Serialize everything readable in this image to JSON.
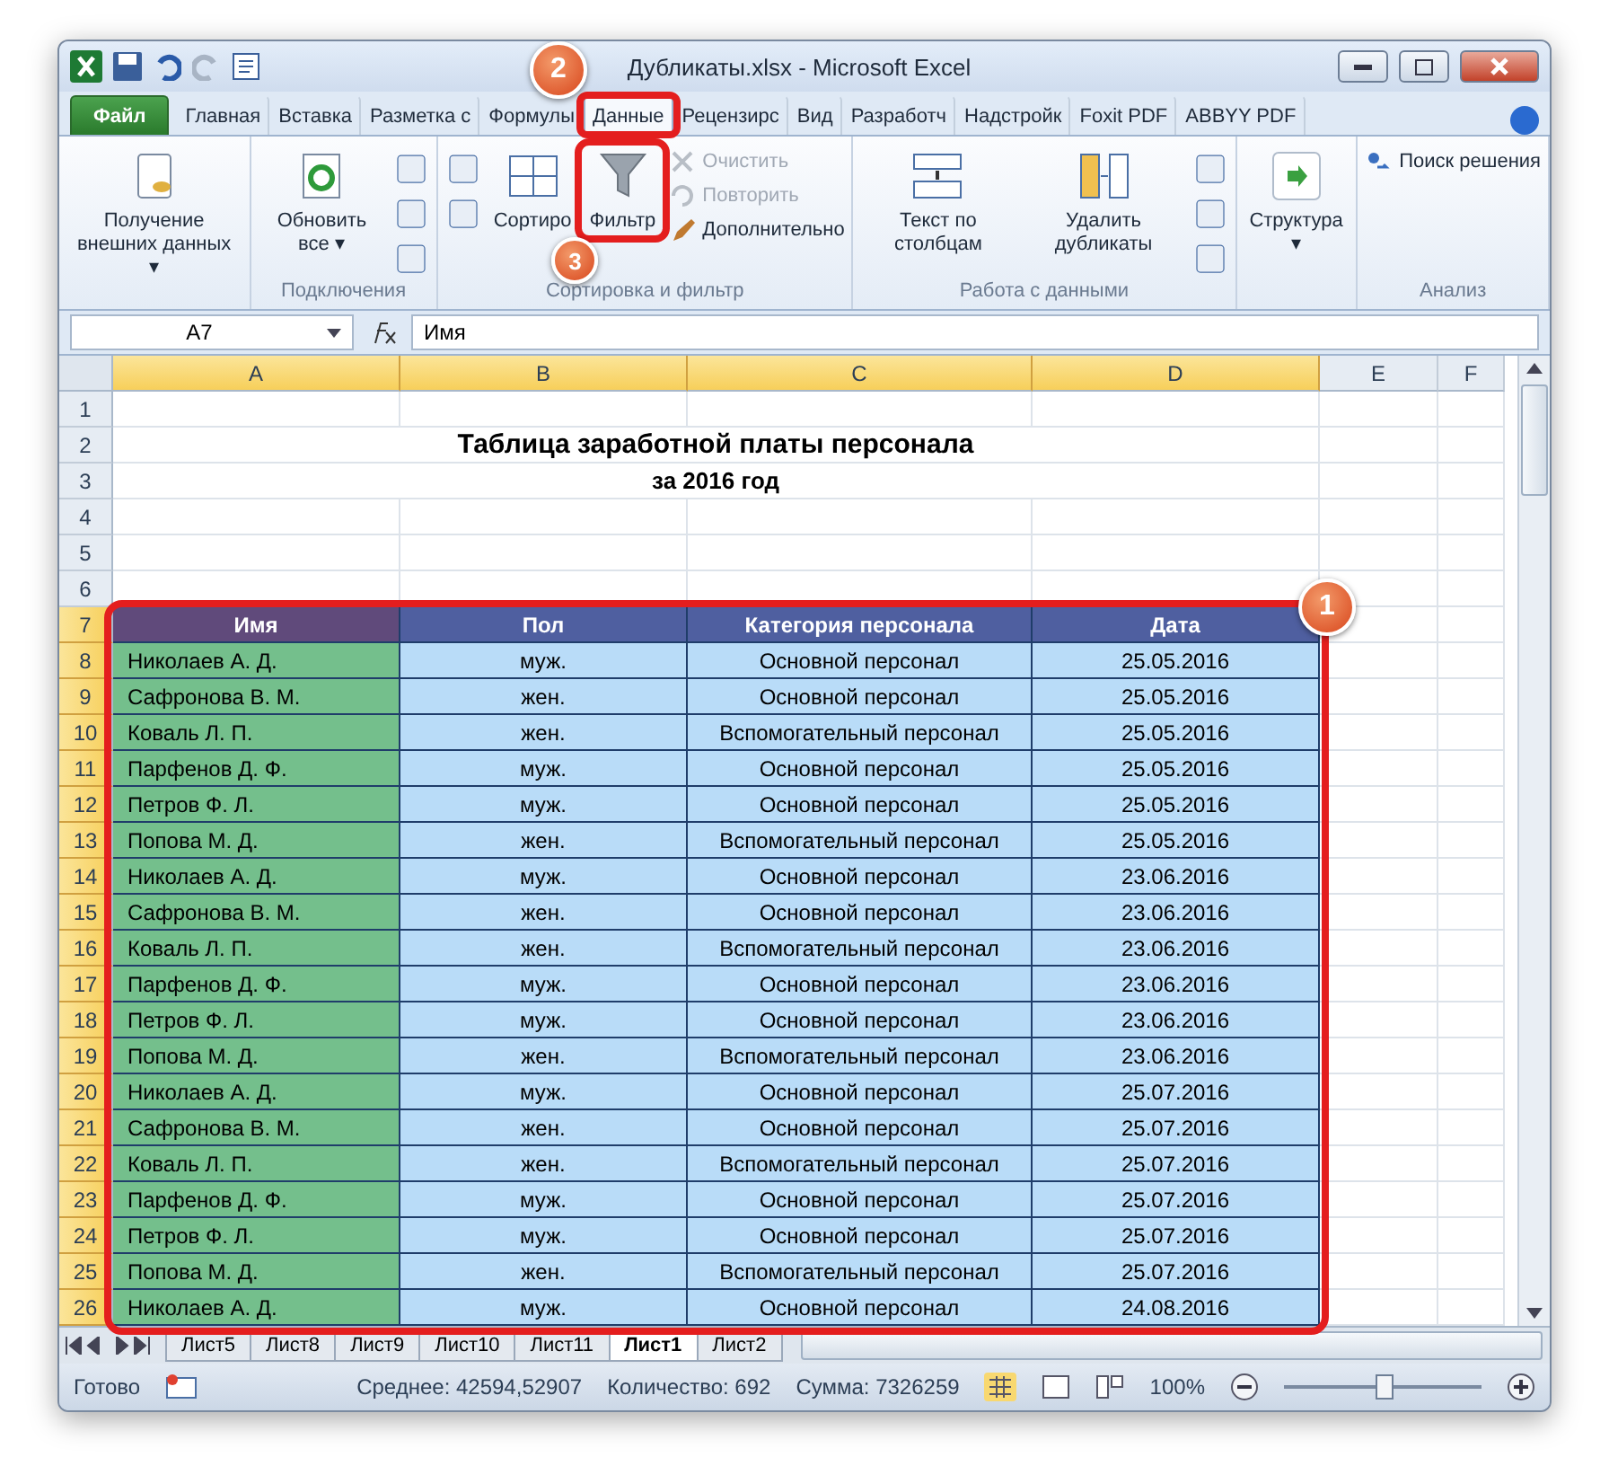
{
  "window": {
    "title": "Дубликаты.xlsx - Microsoft Excel"
  },
  "ribbon_tabs": [
    {
      "label": "Файл",
      "kind": "file",
      "selected": false
    },
    {
      "label": "Главная",
      "kind": "tab",
      "selected": false
    },
    {
      "label": "Вставка",
      "kind": "tab",
      "selected": false
    },
    {
      "label": "Разметка с",
      "kind": "tab",
      "selected": false
    },
    {
      "label": "Формулы",
      "kind": "tab",
      "selected": false
    },
    {
      "label": "Данные",
      "kind": "tab",
      "selected": true
    },
    {
      "label": "Рецензирс",
      "kind": "tab",
      "selected": false
    },
    {
      "label": "Вид",
      "kind": "tab",
      "selected": false
    },
    {
      "label": "Разработч",
      "kind": "tab",
      "selected": false
    },
    {
      "label": "Надстройк",
      "kind": "tab",
      "selected": false
    },
    {
      "label": "Foxit PDF",
      "kind": "tab",
      "selected": false
    },
    {
      "label": "ABBYY PDF",
      "kind": "tab",
      "selected": false
    }
  ],
  "ribbon_groups": [
    {
      "controls": [
        {
          "kind": "large",
          "label": "Получение внешних данных ▾",
          "disabled": false
        }
      ]
    },
    {
      "label": "Подключения",
      "controls": [
        {
          "kind": "large",
          "label": "Обновить все ▾",
          "disabled": false
        },
        {
          "kind": "icons"
        }
      ]
    },
    {
      "label": "Сортировка и фильтр",
      "controls": [
        {
          "kind": "icons"
        },
        {
          "kind": "large",
          "label": "Сортиро",
          "disabled": false
        },
        {
          "kind": "large",
          "label": "Фильтр",
          "disabled": false
        },
        {
          "kind": "small",
          "items": [
            {
              "label": "Очистить",
              "disabled": true
            },
            {
              "label": "Повторить",
              "disabled": true
            },
            {
              "label": "Дополнительно",
              "disabled": false
            }
          ]
        }
      ]
    },
    {
      "label": "Работа с данными",
      "controls": [
        {
          "kind": "large",
          "label": "Текст по столбцам",
          "disabled": false
        },
        {
          "kind": "large",
          "label": "Удалить дубликаты",
          "disabled": false
        },
        {
          "kind": "icons"
        }
      ]
    },
    {
      "controls": [
        {
          "kind": "large",
          "label": "Структура ▾",
          "disabled": false
        }
      ]
    },
    {
      "label": "Анализ",
      "controls": [
        {
          "kind": "small",
          "items": [
            {
              "label": "Поиск решения",
              "disabled": false
            }
          ]
        }
      ]
    }
  ],
  "formula_bar": {
    "name_box": "A7",
    "formula": "Имя"
  },
  "columns": [
    {
      "label": "A",
      "selected": true
    },
    {
      "label": "B",
      "selected": true
    },
    {
      "label": "C",
      "selected": true
    },
    {
      "label": "D",
      "selected": true
    },
    {
      "label": "E",
      "selected": false
    },
    {
      "label": "F",
      "selected": false
    }
  ],
  "rows": [
    {
      "number": "1",
      "kind": "blank",
      "selected": false,
      "cells": []
    },
    {
      "number": "2",
      "kind": "title",
      "selected": false,
      "cells": [
        "Таблица заработной платы персонала"
      ]
    },
    {
      "number": "3",
      "kind": "subtitle",
      "selected": false,
      "cells": [
        "за 2016 год"
      ]
    },
    {
      "number": "4",
      "kind": "blank",
      "selected": false,
      "cells": []
    },
    {
      "number": "5",
      "kind": "blank",
      "selected": false,
      "cells": []
    },
    {
      "number": "6",
      "kind": "blank",
      "selected": false,
      "cells": []
    },
    {
      "number": "7",
      "kind": "header",
      "selected": true,
      "cells": [
        "Имя",
        "Пол",
        "Категория персонала",
        "Дата"
      ]
    },
    {
      "number": "8",
      "kind": "data",
      "selected": true,
      "cells": [
        "Николаев А. Д.",
        "муж.",
        "Основной персонал",
        "25.05.2016"
      ]
    },
    {
      "number": "9",
      "kind": "data",
      "selected": true,
      "cells": [
        "Сафронова В. М.",
        "жен.",
        "Основной персонал",
        "25.05.2016"
      ]
    },
    {
      "number": "10",
      "kind": "data",
      "selected": true,
      "cells": [
        "Коваль Л. П.",
        "жен.",
        "Вспомогательный персонал",
        "25.05.2016"
      ]
    },
    {
      "number": "11",
      "kind": "data",
      "selected": true,
      "cells": [
        "Парфенов Д. Ф.",
        "муж.",
        "Основной персонал",
        "25.05.2016"
      ]
    },
    {
      "number": "12",
      "kind": "data",
      "selected": true,
      "cells": [
        "Петров Ф. Л.",
        "муж.",
        "Основной персонал",
        "25.05.2016"
      ]
    },
    {
      "number": "13",
      "kind": "data",
      "selected": true,
      "cells": [
        "Попова М. Д.",
        "жен.",
        "Вспомогательный персонал",
        "25.05.2016"
      ]
    },
    {
      "number": "14",
      "kind": "data",
      "selected": true,
      "cells": [
        "Николаев А. Д.",
        "муж.",
        "Основной персонал",
        "23.06.2016"
      ]
    },
    {
      "number": "15",
      "kind": "data",
      "selected": true,
      "cells": [
        "Сафронова В. М.",
        "жен.",
        "Основной персонал",
        "23.06.2016"
      ]
    },
    {
      "number": "16",
      "kind": "data",
      "selected": true,
      "cells": [
        "Коваль Л. П.",
        "жен.",
        "Вспомогательный персонал",
        "23.06.2016"
      ]
    },
    {
      "number": "17",
      "kind": "data",
      "selected": true,
      "cells": [
        "Парфенов Д. Ф.",
        "муж.",
        "Основной персонал",
        "23.06.2016"
      ]
    },
    {
      "number": "18",
      "kind": "data",
      "selected": true,
      "cells": [
        "Петров Ф. Л.",
        "муж.",
        "Основной персонал",
        "23.06.2016"
      ]
    },
    {
      "number": "19",
      "kind": "data",
      "selected": true,
      "cells": [
        "Попова М. Д.",
        "жен.",
        "Вспомогательный персонал",
        "23.06.2016"
      ]
    },
    {
      "number": "20",
      "kind": "data",
      "selected": true,
      "cells": [
        "Николаев А. Д.",
        "муж.",
        "Основной персонал",
        "25.07.2016"
      ]
    },
    {
      "number": "21",
      "kind": "data",
      "selected": true,
      "cells": [
        "Сафронова В. М.",
        "жен.",
        "Основной персонал",
        "25.07.2016"
      ]
    },
    {
      "number": "22",
      "kind": "data",
      "selected": true,
      "cells": [
        "Коваль Л. П.",
        "жен.",
        "Вспомогательный персонал",
        "25.07.2016"
      ]
    },
    {
      "number": "23",
      "kind": "data",
      "selected": true,
      "cells": [
        "Парфенов Д. Ф.",
        "муж.",
        "Основной персонал",
        "25.07.2016"
      ]
    },
    {
      "number": "24",
      "kind": "data",
      "selected": true,
      "cells": [
        "Петров Ф. Л.",
        "муж.",
        "Основной персонал",
        "25.07.2016"
      ]
    },
    {
      "number": "25",
      "kind": "data",
      "selected": true,
      "cells": [
        "Попова М. Д.",
        "жен.",
        "Вспомогательный персонал",
        "25.07.2016"
      ]
    },
    {
      "number": "26",
      "kind": "data",
      "selected": true,
      "cells": [
        "Николаев А. Д.",
        "муж.",
        "Основной персонал",
        "24.08.2016"
      ]
    }
  ],
  "sheet_tabs": [
    {
      "label": "Лист5",
      "selected": false
    },
    {
      "label": "Лист8",
      "selected": false
    },
    {
      "label": "Лист9",
      "selected": false
    },
    {
      "label": "Лист10",
      "selected": false
    },
    {
      "label": "Лист11",
      "selected": false
    },
    {
      "label": "Лист1",
      "selected": true
    },
    {
      "label": "Лист2",
      "selected": false
    }
  ],
  "status_bar": {
    "mode": "Готово",
    "average": "Среднее: 42594,52907",
    "count": "Количество: 692",
    "sum": "Сумма: 7326259",
    "zoom": "100%",
    "zoom_level": {
      "level": 0.5
    }
  },
  "callouts": [
    "1",
    "2",
    "3"
  ]
}
